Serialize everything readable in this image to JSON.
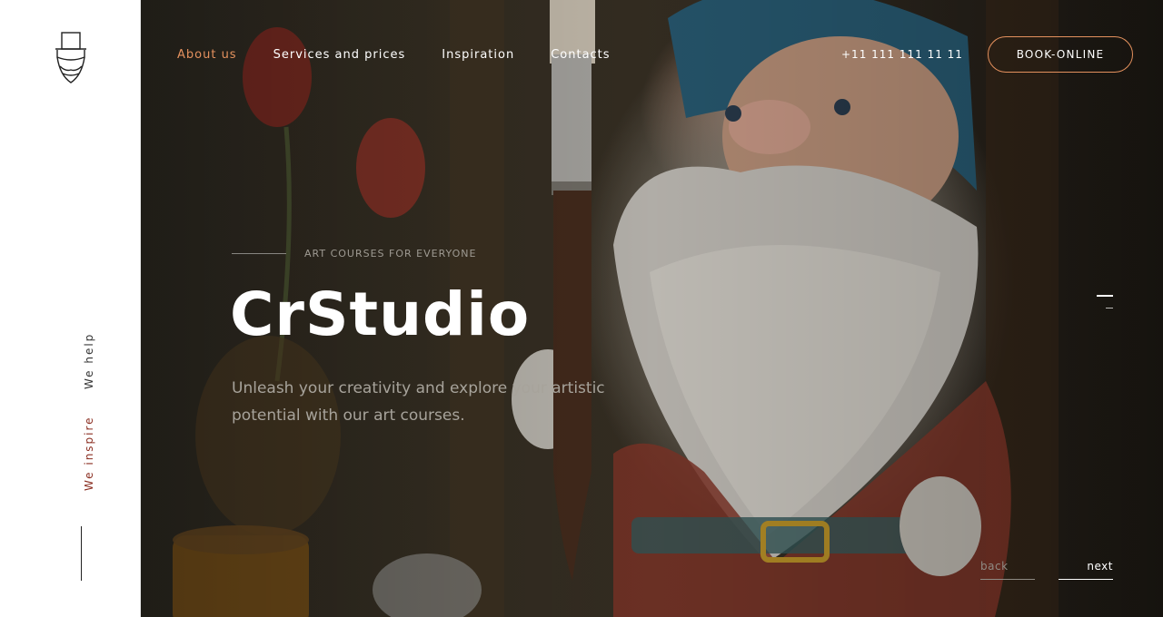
{
  "brand": {
    "logo_icon": "gnome-hat-logo-icon"
  },
  "side": {
    "help": "We help",
    "inspire": "We inspire"
  },
  "nav": {
    "items": [
      {
        "label": "About us",
        "active": true
      },
      {
        "label": "Services and prices",
        "active": false
      },
      {
        "label": "Inspiration",
        "active": false
      },
      {
        "label": "Contacts",
        "active": false
      }
    ],
    "phone": "+11 111 111 11 11",
    "book": "BOOK-ONLINE"
  },
  "hero": {
    "eyebrow": "ART COURSES FOR EVERYONE",
    "title": "CrStudio",
    "subtitle": "Unleash your creativity and explore your artistic potential with our art courses.",
    "back": "back",
    "next": "next"
  },
  "colors": {
    "accent": "#e4915e",
    "inspire_text": "#8b2f22"
  }
}
